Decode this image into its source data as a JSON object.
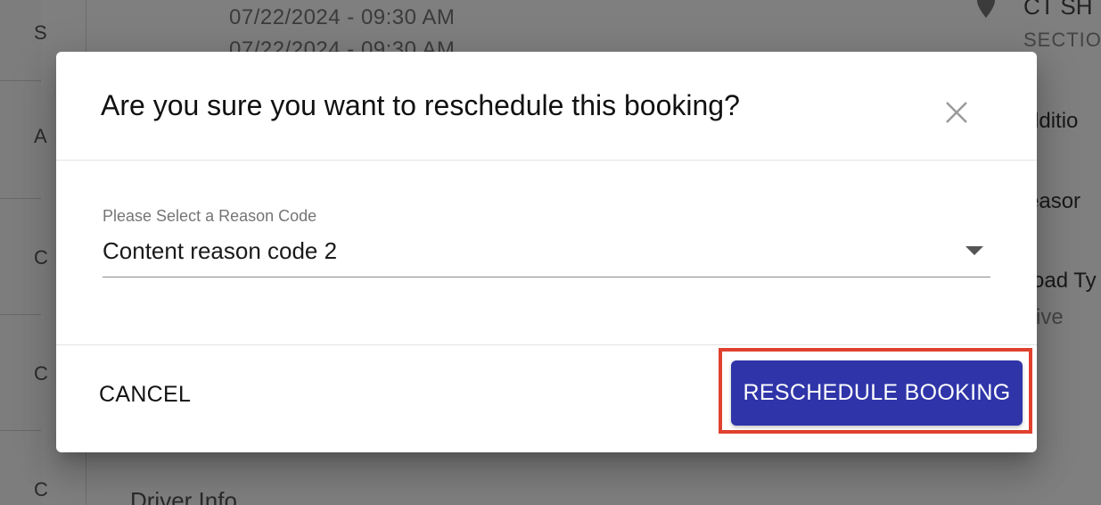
{
  "background": {
    "dates": [
      "07/22/2024 - 09:30 AM",
      "07/22/2024 - 09:30 AM"
    ],
    "right_title": "CT SH",
    "right_subtitle": "SECTIO",
    "right_label_1": "dditio",
    "right_label_2": "easor",
    "right_label_3": "oad Ty",
    "right_value_3": "ive",
    "driver_heading": "Driver Info",
    "rail_glyphs": [
      "S",
      "A",
      "C",
      "C",
      "C"
    ]
  },
  "dialog": {
    "title": "Are you sure you want to reschedule this booking?",
    "close_glyph": "close-icon",
    "reason_field": {
      "label": "Please Select a Reason Code",
      "selected_value": "Content reason code 2"
    },
    "actions": {
      "cancel_label": "CANCEL",
      "confirm_label": "RESCHEDULE BOOKING"
    }
  },
  "colors": {
    "primary": "#2f35a8",
    "highlight": "#e0412f",
    "scrim": "rgba(0,0,0,0.5)"
  }
}
